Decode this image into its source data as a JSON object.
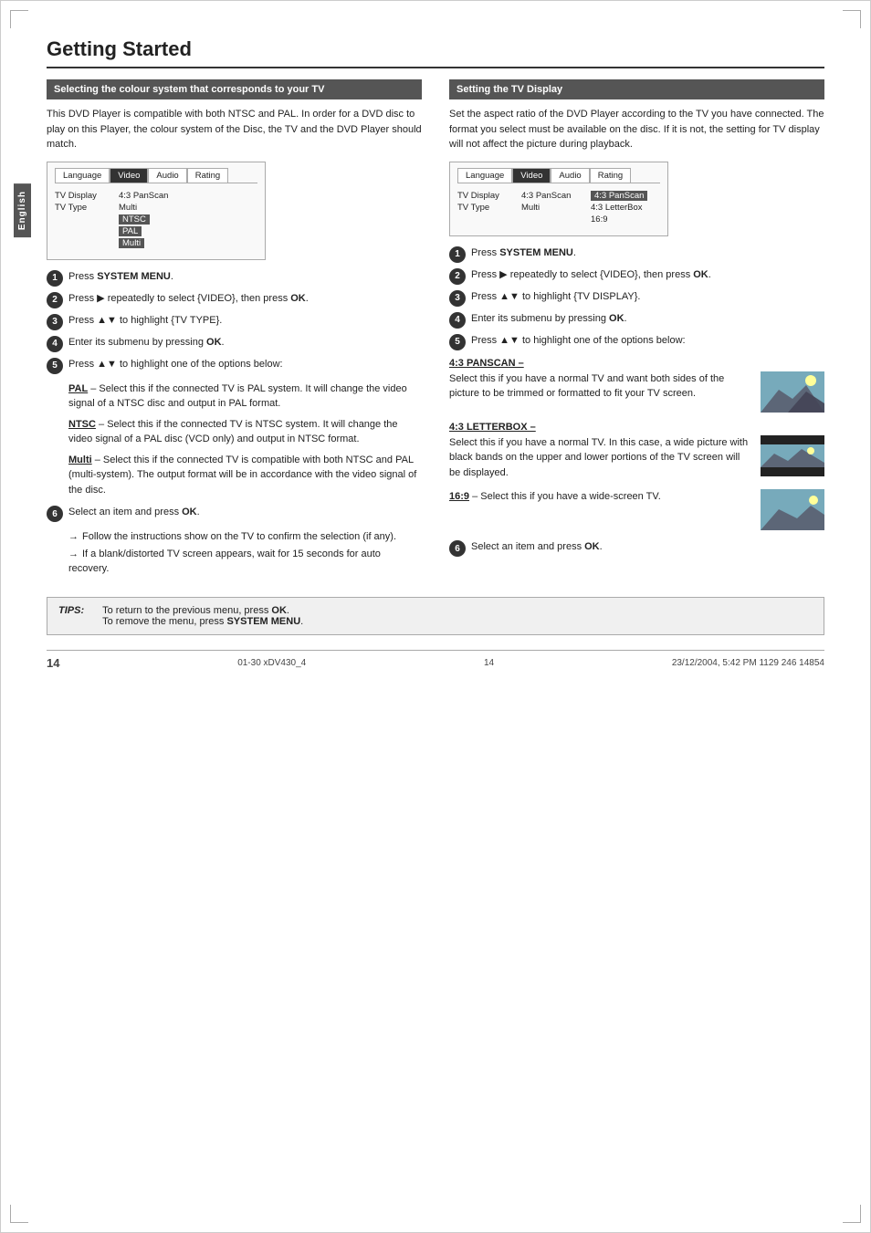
{
  "page": {
    "title": "Getting Started",
    "page_number": "14",
    "footer_left": "01-30 xDV430_4",
    "footer_center": "14",
    "footer_right": "23/12/2004, 5:42 PM  1129 246 14854"
  },
  "side_tab": "English",
  "left_section": {
    "header": "Selecting the colour system that corresponds to your TV",
    "intro": "This DVD Player is compatible with both NTSC and PAL. In order for a DVD disc to play on this Player, the colour system of the Disc, the TV and the DVD Player should match.",
    "menu": {
      "tabs": [
        "Language",
        "Video",
        "Audio",
        "Rating"
      ],
      "active_tab": "Video",
      "rows": [
        {
          "label": "TV Display",
          "value": "4:3 PanScan"
        },
        {
          "label": "TV Type",
          "value": "Multi"
        }
      ],
      "highlighted": [
        "NTSC",
        "PAL",
        "Multi"
      ]
    },
    "steps": [
      {
        "num": "1",
        "text": "Press ",
        "bold": "SYSTEM MENU",
        "after": "."
      },
      {
        "num": "2",
        "text": "Press ",
        "arrow": "▶",
        "after": " repeatedly to select {VIDEO}, then press ",
        "bold2": "OK",
        "end": "."
      },
      {
        "num": "3",
        "text": "Press ▲▼ to highlight {TV TYPE}."
      },
      {
        "num": "4",
        "text": "Enter its submenu by pressing ",
        "bold": "OK",
        "after": "."
      },
      {
        "num": "5",
        "text": "Press ▲▼ to highlight one of the options below:"
      }
    ],
    "options": [
      {
        "label": "PAL",
        "text": "– Select this if the connected TV is PAL system. It will change the video signal of a NTSC disc and output in PAL format."
      },
      {
        "label": "NTSC",
        "text": "– Select this if the connected TV is NTSC system. It will change the video signal of a PAL disc (VCD only) and output in NTSC format."
      },
      {
        "label": "Multi",
        "text": "– Select this if the connected TV is compatible with both NTSC and PAL (multi-system). The output format will be in accordance with the video signal of the disc."
      }
    ],
    "step6": {
      "num": "6",
      "text": "Select an item and press ",
      "bold": "OK",
      "after": "."
    },
    "sub_arrows": [
      "Follow the instructions show on the TV to confirm the selection (if any).",
      "If a blank/distorted TV screen appears, wait for 15 seconds for auto recovery."
    ]
  },
  "right_section": {
    "header": "Setting the TV Display",
    "intro": "Set the aspect ratio of the DVD Player according to the TV you have connected. The format you select must be available on the disc. If it is not, the setting for TV display will not affect the picture during playback.",
    "menu": {
      "tabs": [
        "Language",
        "Video",
        "Audio",
        "Rating"
      ],
      "active_tab": "Video",
      "rows": [
        {
          "label": "TV Display",
          "value": "4:3 PanScan"
        },
        {
          "label": "TV Type",
          "value": "Multi"
        }
      ],
      "highlighted_col": [
        "4:3 PanScan",
        "4:3 LetterBox",
        "16:9"
      ]
    },
    "steps": [
      {
        "num": "1",
        "text": "Press ",
        "bold": "SYSTEM MENU",
        "after": "."
      },
      {
        "num": "2",
        "text": "Press ▶ repeatedly to select {VIDEO}, then press ",
        "bold": "OK",
        "after": "."
      },
      {
        "num": "3",
        "text": "Press ▲▼ to highlight {TV DISPLAY}."
      },
      {
        "num": "4",
        "text": "Enter its submenu by pressing ",
        "bold": "OK",
        "after": "."
      },
      {
        "num": "5",
        "text": "Press ▲▼ to highlight one of the options below:"
      }
    ],
    "tv_options": [
      {
        "label": "4:3 PANSCAN –",
        "text": "Select this if you have a normal TV and want both sides of the picture to be trimmed or formatted to fit your TV screen."
      },
      {
        "label": "4:3 LETTERBOX –",
        "text": "Select this if you have a normal TV. In this case, a wide picture with black bands on the upper and lower portions of the TV screen will be displayed."
      },
      {
        "label": "16:9",
        "text": "– Select this if you have a wide-screen TV."
      }
    ],
    "step6": {
      "num": "6",
      "text": "Select an item and press ",
      "bold": "OK",
      "after": "."
    }
  },
  "tips": {
    "label": "TIPS:",
    "lines": [
      "To return to the previous menu, press OK.",
      "To remove the menu, press SYSTEM MENU."
    ]
  }
}
